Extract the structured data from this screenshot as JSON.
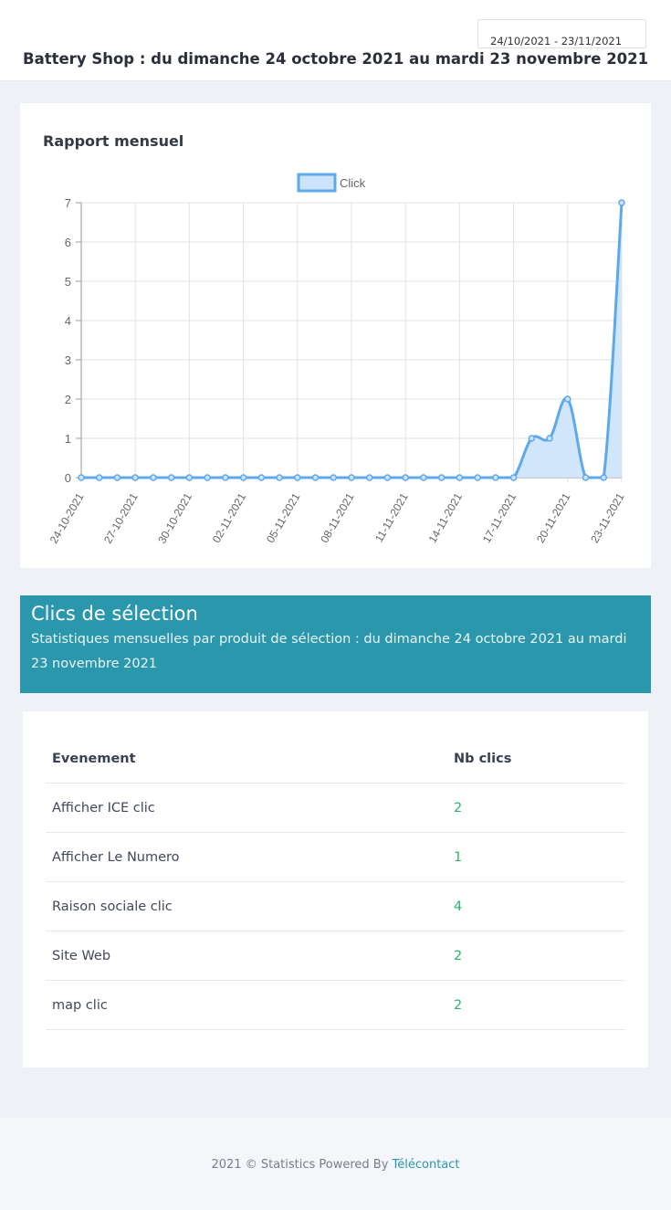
{
  "header": {
    "date_range": "24/10/2021 - 23/11/2021",
    "title": "Battery Shop : du dimanche 24 octobre 2021 au mardi 23 novembre 2021"
  },
  "report": {
    "title": "Rapport mensuel"
  },
  "chart_data": {
    "type": "area",
    "title": "",
    "xlabel": "",
    "ylabel": "",
    "legend": [
      "Click"
    ],
    "legend_position": "top",
    "ylim": [
      0,
      7
    ],
    "yticks": [
      "0",
      "1",
      "2",
      "3",
      "4",
      "5",
      "6",
      "7"
    ],
    "grid": true,
    "x": [
      "24-10-2021",
      "25-10-2021",
      "26-10-2021",
      "27-10-2021",
      "28-10-2021",
      "29-10-2021",
      "30-10-2021",
      "31-10-2021",
      "01-11-2021",
      "02-11-2021",
      "03-11-2021",
      "04-11-2021",
      "05-11-2021",
      "06-11-2021",
      "07-11-2021",
      "08-11-2021",
      "09-11-2021",
      "10-11-2021",
      "11-11-2021",
      "12-11-2021",
      "13-11-2021",
      "14-11-2021",
      "15-11-2021",
      "16-11-2021",
      "17-11-2021",
      "18-11-2021",
      "19-11-2021",
      "20-11-2021",
      "21-11-2021",
      "22-11-2021",
      "23-11-2021"
    ],
    "xtick_labels": [
      "24-10-2021",
      "27-10-2021",
      "30-10-2021",
      "02-11-2021",
      "05-11-2021",
      "08-11-2021",
      "11-11-2021",
      "14-11-2021",
      "17-11-2021",
      "20-11-2021",
      "23-11-2021"
    ],
    "series": [
      {
        "name": "Click",
        "values": [
          0,
          0,
          0,
          0,
          0,
          0,
          0,
          0,
          0,
          0,
          0,
          0,
          0,
          0,
          0,
          0,
          0,
          0,
          0,
          0,
          0,
          0,
          0,
          0,
          0,
          1,
          1,
          2,
          0,
          0,
          7
        ]
      }
    ],
    "colors": {
      "line": "#5ea9ec",
      "fill": "#cce3fa",
      "grid": "#e3e3e3",
      "axis": "#999999"
    }
  },
  "selection": {
    "title": "Clics de sélection",
    "subtitle": "Statistiques mensuelles par produit de sélection : du dimanche 24 octobre 2021 au mardi 23 novembre 2021"
  },
  "table": {
    "headers": [
      "Evenement",
      "Nb clics"
    ],
    "rows": [
      {
        "event": "Afficher ICE clic",
        "clicks": "2"
      },
      {
        "event": "Afficher Le Numero",
        "clicks": "1"
      },
      {
        "event": "Raison sociale clic",
        "clicks": "4"
      },
      {
        "event": "Site Web",
        "clicks": "2"
      },
      {
        "event": "map clic",
        "clicks": "2"
      }
    ]
  },
  "footer": {
    "text": "2021 © Statistics Powered By ",
    "link": "Télécontact"
  }
}
